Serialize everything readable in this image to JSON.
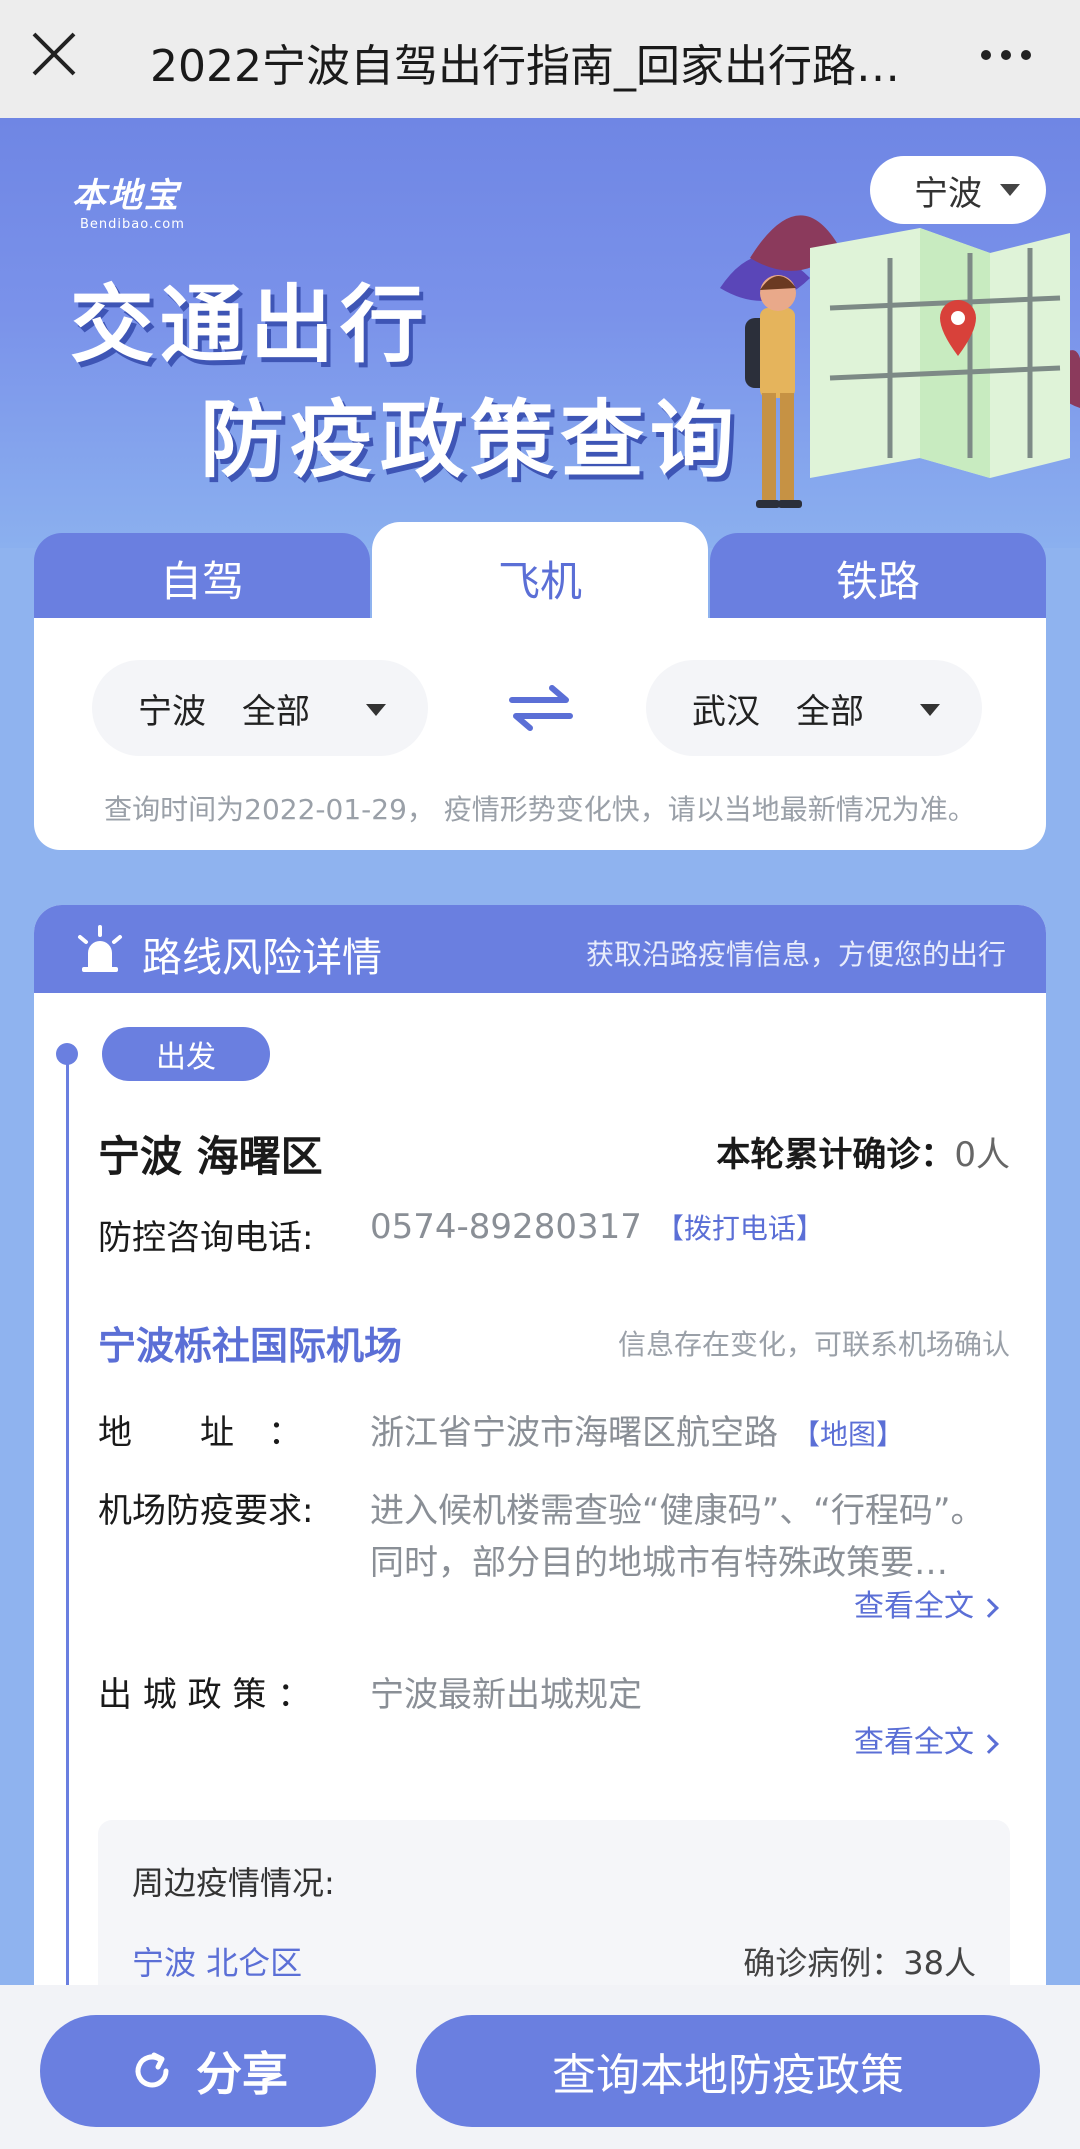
{
  "topbar": {
    "title": "2022宁波自驾出行指南_回家出行路…",
    "close_icon": "close-icon",
    "more_icon": "more-icon"
  },
  "banner": {
    "logo_main": "本地宝",
    "logo_sub": "Bendibao.com",
    "headline_1": "交通出行",
    "headline_2": "防疫政策查询",
    "city": "宁波"
  },
  "tabs": [
    {
      "label": "自驾",
      "active": false
    },
    {
      "label": "飞机",
      "active": true
    },
    {
      "label": "铁路",
      "active": false
    }
  ],
  "route": {
    "from_city": "宁波",
    "from_district": "全部",
    "to_city": "武汉",
    "to_district": "全部",
    "note": "查询时间为2022-01-29， 疫情形势变化快，请以当地最新情况为准。"
  },
  "risk": {
    "title": "路线风险详情",
    "subtitle": "获取沿路疫情信息，方便您的出行",
    "depart_badge": "出发",
    "place": "宁波 海曙区",
    "cases_label": "本轮累计确诊：",
    "cases_value": "0人",
    "phone_label": "防控咨询电话:",
    "phone_value": "0574-89280317",
    "phone_link": "【拨打电话】",
    "airport_name": "宁波栎社国际机场",
    "airport_note": "信息存在变化，可联系机场确认",
    "address_label": "地　　址　：",
    "address_value": "浙江省宁波市海曙区航空路",
    "map_link": "【地图】",
    "req_label": "机场防疫要求:",
    "req_line1": "进入候机楼需查验“健康码”、“行程码”。",
    "req_line2": "同时，部分目的地城市有特殊政策要…",
    "view_full": "查看全文",
    "exit_label": "出 城 政 策 ：",
    "exit_value": "宁波最新出城规定",
    "view_full_2": "查看全文"
  },
  "nearby": {
    "title": "周边疫情情况:",
    "area": "宁波 北仑区",
    "cases": "确诊病例：38人"
  },
  "bottom": {
    "share_label": "分享",
    "query_label": "查询本地防疫政策"
  },
  "colors": {
    "accent": "#6a7fe0",
    "link": "#5b6fd6",
    "muted": "#9aa0a8"
  }
}
